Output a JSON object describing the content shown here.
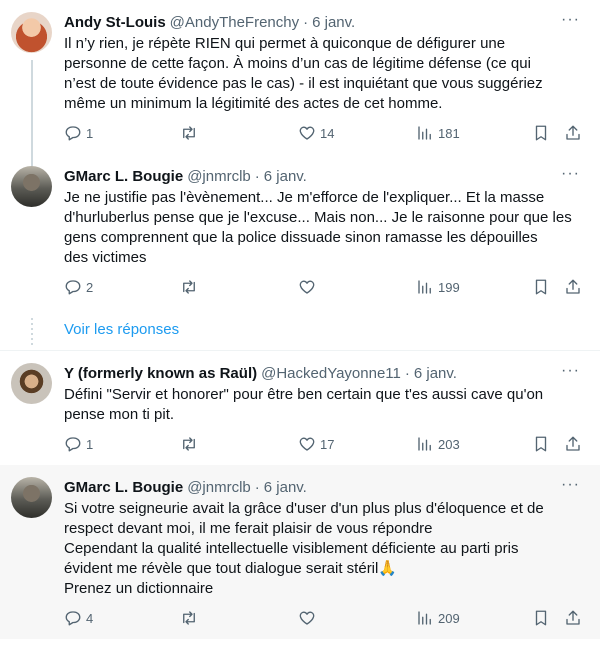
{
  "tweets": [
    {
      "name": "Andy St-Louis",
      "handle": "@AndyTheFrenchy",
      "date": "6 janv.",
      "text": "Il n’y rien, je répète RIEN qui permet à quiconque de défigurer une\npersonne de cette façon. À moins d’un cas de légitime défense (ce qui\nn’est de toute évidence pas le cas) - il est inquiétant que vous suggériez\nmême un minimum la légitimité des actes de cet homme.",
      "replies": "1",
      "retweets": "",
      "likes": "14",
      "views": "181"
    },
    {
      "name": "GMarc L. Bougie",
      "handle": "@jnmrclb",
      "date": "6 janv.",
      "text": "Je ne justifie pas l'èvènement... Je m'efforce de l'expliquer... Et la masse\nd'hurluberlus pense que je l'excuse... Mais non... Je le raisonne pour que les\ngens comprennent que la police dissuade sinon ramasse les dépouilles\ndes victimes",
      "replies": "2",
      "retweets": "",
      "likes": "",
      "views": "199"
    },
    {
      "name": "Y (formerly known as Raül)",
      "handle": "@HackedYayonne11",
      "date": "6 janv.",
      "text": "Défini \"Servir et honorer\" pour être ben certain que t'es aussi cave qu'on\npense mon ti pit.",
      "replies": "1",
      "retweets": "",
      "likes": "17",
      "views": "203"
    },
    {
      "name": "GMarc L. Bougie",
      "handle": "@jnmrclb",
      "date": "6 janv.",
      "text": "Si votre seigneurie avait la grâce d'user d'un plus plus d'éloquence et de\nrespect devant moi, il me ferait plaisir de vous répondre\nCependant la qualité intellectuelle visiblement déficiente au parti pris\névident me révèle que tout dialogue serait stéril🙏\nPrenez un dictionnaire",
      "replies": "4",
      "retweets": "",
      "likes": "",
      "views": "209"
    }
  ],
  "show_replies_label": "Voir les réponses",
  "more_label": "···",
  "colors": {
    "accent": "#1d9bf0",
    "muted": "#536471",
    "highlight_bg": "#f7f7f7"
  }
}
